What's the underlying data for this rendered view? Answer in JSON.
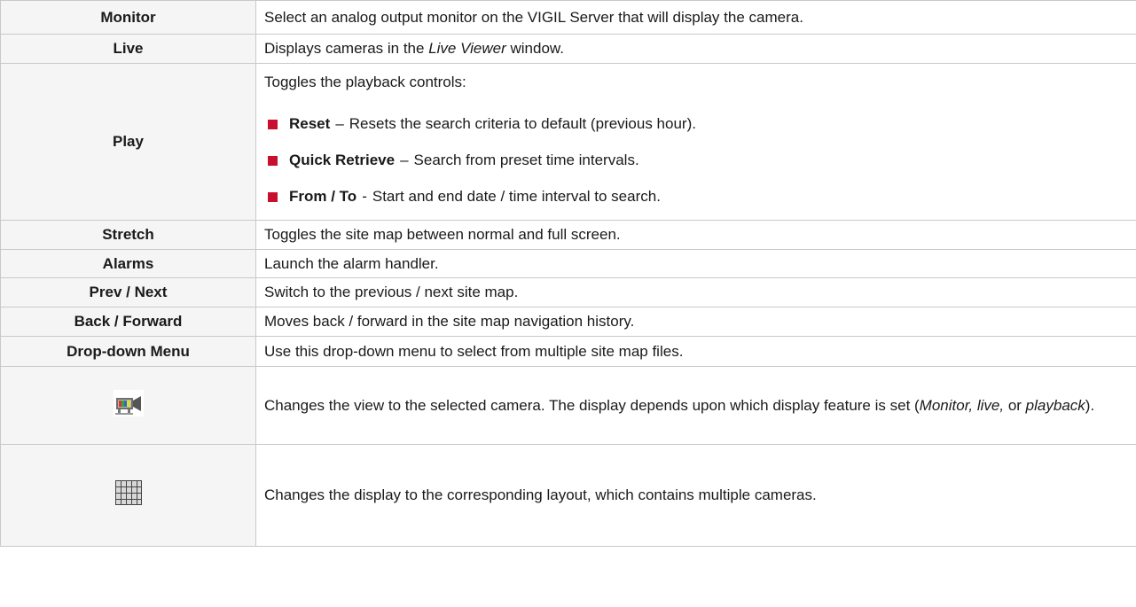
{
  "rows": [
    {
      "term": "Monitor",
      "desc": "Select an analog output monitor on the VIGIL Server that will display the camera."
    },
    {
      "term": "Live",
      "desc_pre": "Displays cameras in the ",
      "desc_em": "Live Viewer",
      "desc_post": " window."
    },
    {
      "term": "Play",
      "intro": "Toggles the playback controls:",
      "bullets": [
        {
          "label": "Reset",
          "sep": "–",
          "text": "Resets the search criteria to default (previous hour)."
        },
        {
          "label": "Quick Retrieve",
          "sep": "–",
          "text": "Search from preset time intervals."
        },
        {
          "label": "From / To",
          "sep": "-",
          "text": "Start and end date / time interval to search."
        }
      ]
    },
    {
      "term": "Stretch",
      "desc": "Toggles the site map between normal and full screen."
    },
    {
      "term": "Alarms",
      "desc": "Launch the alarm handler."
    },
    {
      "term": "Prev / Next",
      "desc": "Switch to the previous / next site map."
    },
    {
      "term": "Back / Forward",
      "desc": "Moves back / forward in the site map navigation history."
    },
    {
      "term": "Drop-down Menu",
      "desc": "Use this drop-down menu to select from multiple site map files."
    },
    {
      "icon": "camera-icon",
      "desc_pre": "Changes the view to the selected camera. The display depends upon which display feature is set (",
      "desc_em1": "Monitor, live,",
      "desc_mid": " or ",
      "desc_em2": "playback",
      "desc_post": ")."
    },
    {
      "icon": "layout-grid-icon",
      "desc": "Changes the display to the corresponding layout, which contains multiple cameras."
    }
  ],
  "colors": {
    "border": "#c9c9c9",
    "term_bg": "#f5f5f5",
    "bullet": "#c8102e"
  }
}
